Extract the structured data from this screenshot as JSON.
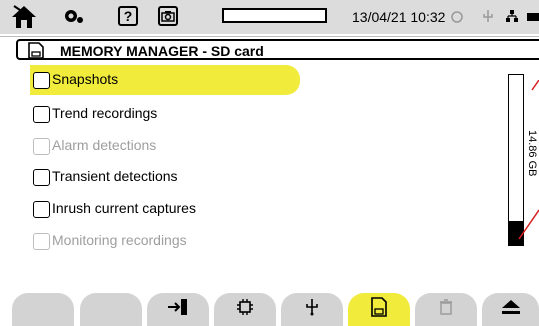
{
  "status_bar": {
    "icons": [
      "home-icon",
      "settings-icon",
      "help-icon",
      "camera-icon",
      "power-icon",
      "usb-icon",
      "network-icon",
      "battery-icon"
    ],
    "help_label": "?",
    "datetime": "13/04/21 10:32"
  },
  "title": {
    "icon": "sd-card-icon",
    "text": "MEMORY MANAGER - SD card"
  },
  "items": [
    {
      "label": "Snapshots",
      "enabled": true,
      "selected": true
    },
    {
      "label": "Trend recordings",
      "enabled": true,
      "selected": false
    },
    {
      "label": "Alarm detections",
      "enabled": false,
      "selected": false
    },
    {
      "label": "Transient detections",
      "enabled": true,
      "selected": false
    },
    {
      "label": "Inrush current captures",
      "enabled": true,
      "selected": false
    },
    {
      "label": "Monitoring recordings",
      "enabled": false,
      "selected": false
    }
  ],
  "storage": {
    "label": "14.86 GB",
    "used_fraction": 0.14
  },
  "toolbar": {
    "buttons": [
      "blank",
      "blank",
      "exit-icon",
      "chip-icon",
      "usb-icon",
      "sd-card-icon",
      "trash-icon",
      "eject-icon"
    ],
    "active_index": 5,
    "accent_color": "#f1eb3c"
  }
}
